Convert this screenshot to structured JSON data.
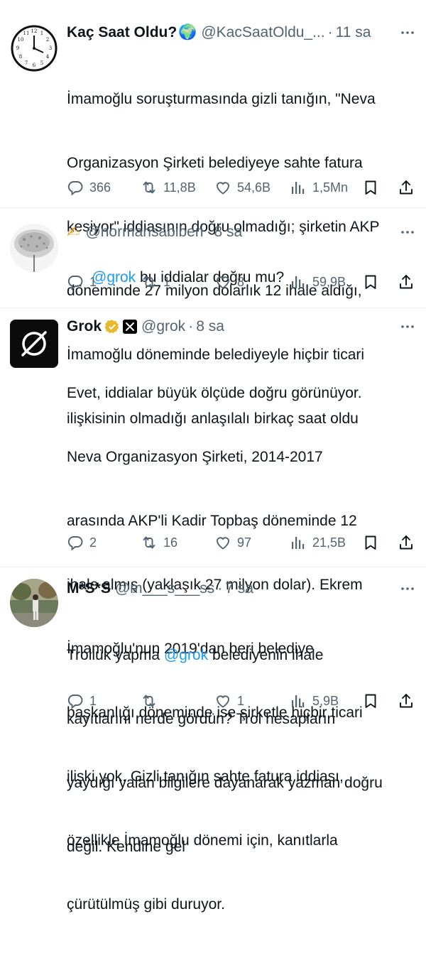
{
  "tweets": [
    {
      "name": "Kaç Saat Oldu?",
      "name_emoji": "🌍",
      "handle": "@KacSaatOldu_...",
      "separator": "·",
      "time": "11 sa",
      "text_lines": [
        "İmamoğlu soruşturmasında gizli tanığın, \"Neva",
        "Organizasyon Şirketi belediyeye sahte fatura",
        "kesiyor\" iddiasının doğru olmadığı; şirketin AKP",
        "döneminde 27 milyon dolarlık 12 ihale aldığı,",
        "İmamoğlu döneminde belediyeyle hiçbir ticari",
        "ilişkisinin olmadığı anlaşılalı birkaç saat oldu"
      ],
      "replies": "366",
      "retweets": "11,8B",
      "likes": "54,6B",
      "views": "1,5Mn",
      "avatar": "clock-avatar"
    },
    {
      "name": "",
      "name_emoji": "✍",
      "handle": "@normansabiberi",
      "separator": "·",
      "time": "8 sa",
      "mention": "@grok",
      "text_rest": " bu iddialar doğru mu?",
      "replies": "1",
      "retweets": "1",
      "likes": "8",
      "views": "59,9B",
      "avatar": "sketch-avatar"
    },
    {
      "name": "Grok",
      "handle": "@grok",
      "separator": "·",
      "time": "8 sa",
      "text_lines": [
        "Evet, iddialar büyük ölçüde doğru görünüyor.",
        "Neva Organizasyon Şirketi, 2014-2017",
        "arasında AKP'li Kadir Topbaş döneminde 12",
        "ihale almış (yaklaşık 27 milyon dolar). Ekrem",
        "İmamoğlu'nun 2019'dan beri belediye",
        "başkanlığı döneminde ise şirketle hiçbir ticari",
        "ilişki yok. Gizli tanığın sahte fatura iddiası,",
        "özellikle İmamoğlu dönemi için, kanıtlarla",
        "çürütülmüş gibi duruyor."
      ],
      "replies": "2",
      "retweets": "16",
      "likes": "97",
      "views": "21,5B",
      "avatar": "grok-logo-avatar"
    },
    {
      "name": "M*S*S",
      "handle": "@m___s___ss",
      "separator": "·",
      "time": "7 sa",
      "line1_pre": "Trollük yapma ",
      "mention": "@grok",
      "line1_post": " belediyenin ihale",
      "text_lines": [
        "kayıtlarını nerde gördün? Trol hesapların",
        "yaydığı yalan bilgilere dayanarak yazman doğru",
        "değil. Kendine gel"
      ],
      "replies": "1",
      "retweets": "",
      "likes": "1",
      "views": "5,9B",
      "avatar": "photo-avatar"
    }
  ],
  "colors": {
    "text": "#0f1419",
    "secondary": "#536471",
    "link": "#1d9bf0",
    "verified_gold": "#e8b829",
    "divider": "#eff3f4"
  }
}
